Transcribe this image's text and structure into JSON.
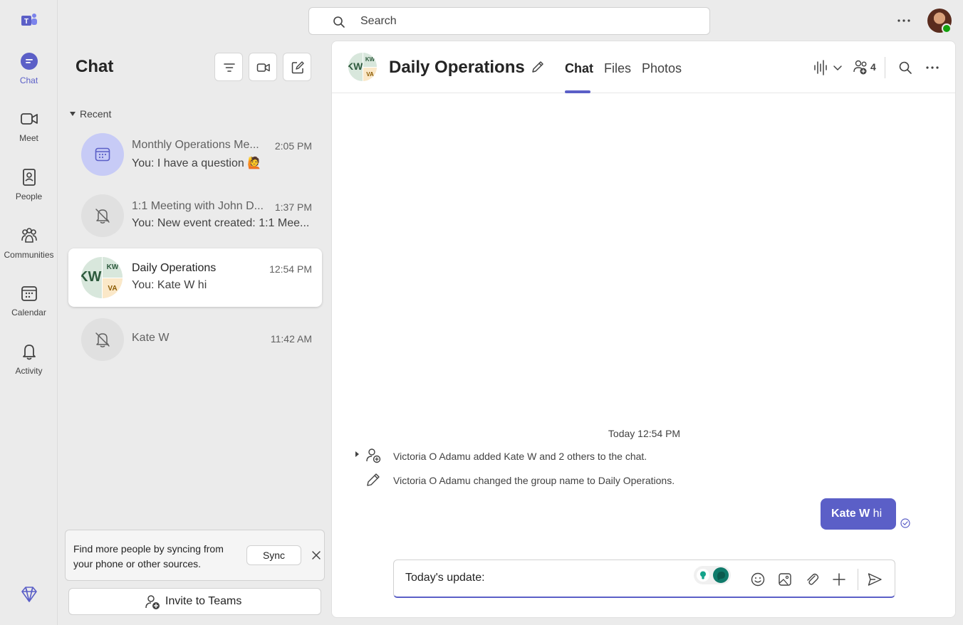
{
  "rail": {
    "items": [
      {
        "label": "Chat"
      },
      {
        "label": "Meet"
      },
      {
        "label": "People"
      },
      {
        "label": "Communities"
      },
      {
        "label": "Calendar"
      },
      {
        "label": "Activity"
      }
    ]
  },
  "search": {
    "placeholder": "Search"
  },
  "chat_list": {
    "title": "Chat",
    "section": "Recent",
    "items": [
      {
        "name": "Monthly Operations Me...",
        "time": "2:05 PM",
        "preview": "You: I have a question 🙋"
      },
      {
        "name": "1:1 Meeting with John D...",
        "time": "1:37 PM",
        "preview": "You: New event created: 1:1 Mee..."
      },
      {
        "name": "Daily Operations",
        "time": "12:54 PM",
        "preview": "You: Kate W hi",
        "initials_a": "KW",
        "initials_b": "VA",
        "initials_c": "KW"
      },
      {
        "name": "Kate W",
        "time": "11:42 AM",
        "preview": ""
      }
    ],
    "sync_text": "Find more people by syncing from your phone or other sources.",
    "sync_button": "Sync",
    "invite_label": "Invite to Teams"
  },
  "conversation": {
    "title": "Daily Operations",
    "tabs": [
      {
        "label": "Chat"
      },
      {
        "label": "Files"
      },
      {
        "label": "Photos"
      }
    ],
    "participants_count": "4",
    "timestamp": "Today 12:54 PM",
    "events": [
      "Victoria O Adamu added Kate W and 2 others to the chat.",
      "Victoria O Adamu changed the group name to Daily Operations."
    ],
    "message": {
      "mention": "Kate W",
      "text": " hi"
    },
    "compose_value": "Today's update:"
  },
  "colors": {
    "accent": "#5b5fc7",
    "rail_bg": "#ebebeb",
    "status_green": "#13a10e"
  }
}
